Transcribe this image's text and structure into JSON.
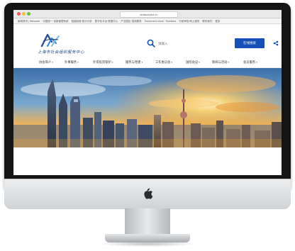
{
  "window": {
    "url": "shdaofudzt.cn"
  },
  "bookmarks": {
    "items": [
      "新闻资讯 | Welcome",
      "中国统一·创新管理系统",
      "智能制造·统计分析",
      "数字化平台·数据中心",
      "产业园区·招商服务",
      "Tomorrow's cloud · Solutions",
      "行政审批·网上服务",
      "联系我们",
      "更多"
    ]
  },
  "site": {
    "logo_text": "上海市社会组织服务中心"
  },
  "search": {
    "placeholder": "请输入",
    "button_label": "在线搜索"
  },
  "nav": {
    "items": [
      {
        "label": "协会简介"
      },
      {
        "label": "外事服务"
      },
      {
        "label": "外资投资保护"
      },
      {
        "label": "服务与党建"
      },
      {
        "label": "工作委员会"
      },
      {
        "label": "国际会议"
      },
      {
        "label": "新闻与活动"
      },
      {
        "label": "会员服务"
      }
    ]
  },
  "colors": {
    "accent": "#1450b8",
    "bezel": "#141414",
    "sunset": "#f4a52a"
  },
  "icons": {
    "search": "search-icon",
    "menu": "share-icon",
    "brand": "apple-logo-icon"
  }
}
